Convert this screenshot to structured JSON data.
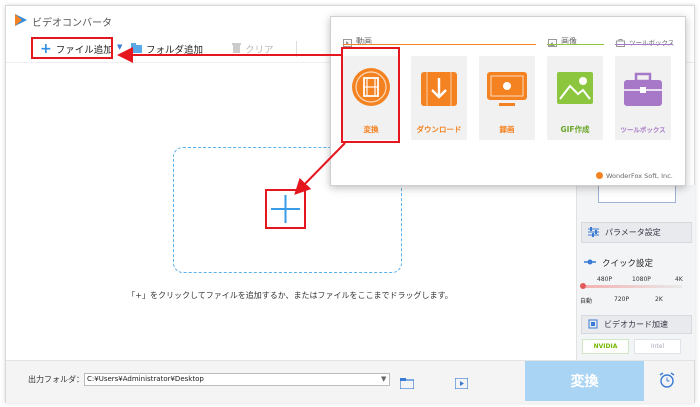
{
  "app": {
    "title": "ビデオコンバータ"
  },
  "toolbar": {
    "add_file": "ファイル追加",
    "add_folder": "フォルダ追加",
    "clear": "クリア"
  },
  "dropzone": {
    "hint": "「+」をクリックしてファイルを追加するか、またはファイルをここまでドラッグします。"
  },
  "popup": {
    "sections": {
      "video": "動画",
      "image": "画像",
      "toolbox": "ツールボックス"
    },
    "tiles": [
      {
        "label": "変換",
        "icon": "film-convert-icon"
      },
      {
        "label": "ダウンロード",
        "icon": "download-icon"
      },
      {
        "label": "録画",
        "icon": "screen-record-icon"
      },
      {
        "label": "GIF作成",
        "icon": "gif-image-icon"
      },
      {
        "label": "ツールボックス",
        "icon": "toolbox-icon"
      }
    ],
    "brand": "WonderFox Soft, Inc."
  },
  "right_panel": {
    "params": "パラメータ設定",
    "quick": "クイック設定",
    "quality_top": [
      "480P",
      "1080P",
      "4K"
    ],
    "quality_bottom": [
      "自動",
      "720P",
      "2K"
    ],
    "gpu": "ビデオカード加速",
    "nvidia": "NVIDIA",
    "intel": "Intel"
  },
  "bottom": {
    "output_label": "出力フォルダ：",
    "output_path": "C:¥Users¥Administrator¥Desktop",
    "convert": "変換"
  },
  "colors": {
    "accent_orange": "#f58220",
    "accent_blue": "#2f8ee0",
    "annotation_red": "#e5161e",
    "convert_button": "#a9d4f3"
  }
}
